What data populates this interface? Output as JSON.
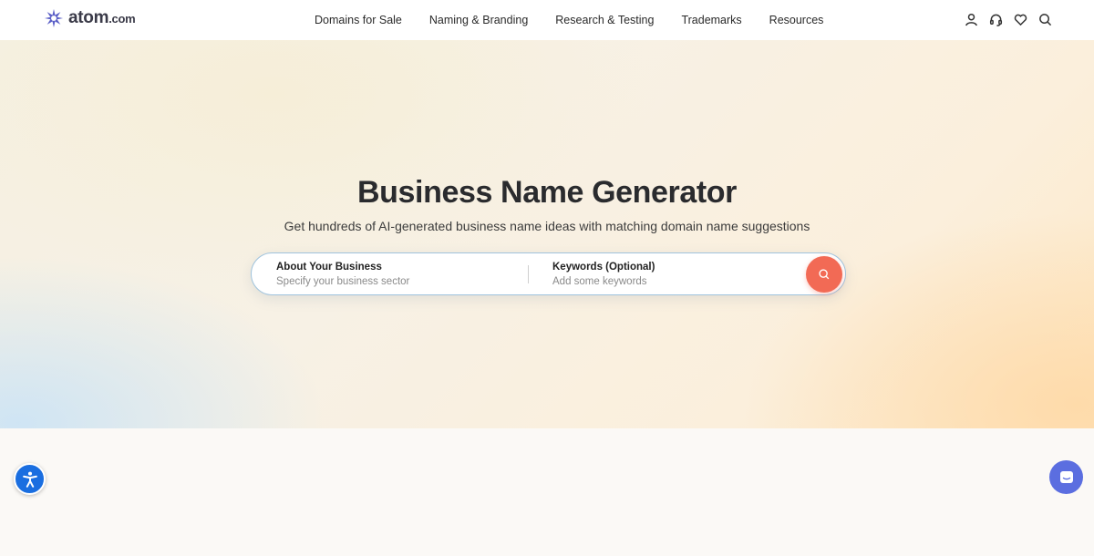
{
  "brand": {
    "name": "atom",
    "suffix": ".com",
    "logo_icon": "atom-star-logo",
    "color": "#5b5fc7"
  },
  "nav": {
    "items": [
      {
        "label": "Domains for Sale"
      },
      {
        "label": "Naming & Branding"
      },
      {
        "label": "Research & Testing"
      },
      {
        "label": "Trademarks"
      },
      {
        "label": "Resources"
      }
    ]
  },
  "header_icons": [
    "user-icon",
    "headset-icon",
    "heart-icon",
    "search-icon"
  ],
  "hero": {
    "title": "Business Name Generator",
    "subtitle": "Get hundreds of AI-generated business name ideas with matching domain name suggestions"
  },
  "search": {
    "business": {
      "label": "About Your Business",
      "placeholder": "Specify your business sector",
      "value": ""
    },
    "keywords": {
      "label": "Keywords (Optional)",
      "placeholder": "Add some keywords",
      "value": ""
    },
    "button_icon": "search-icon",
    "button_color": "#f26a55"
  },
  "widgets": {
    "accessibility_icon": "accessibility-icon",
    "accessibility_color": "#1a6ee0",
    "chat_icon": "chat-icon",
    "chat_color": "#5b6ee0"
  }
}
